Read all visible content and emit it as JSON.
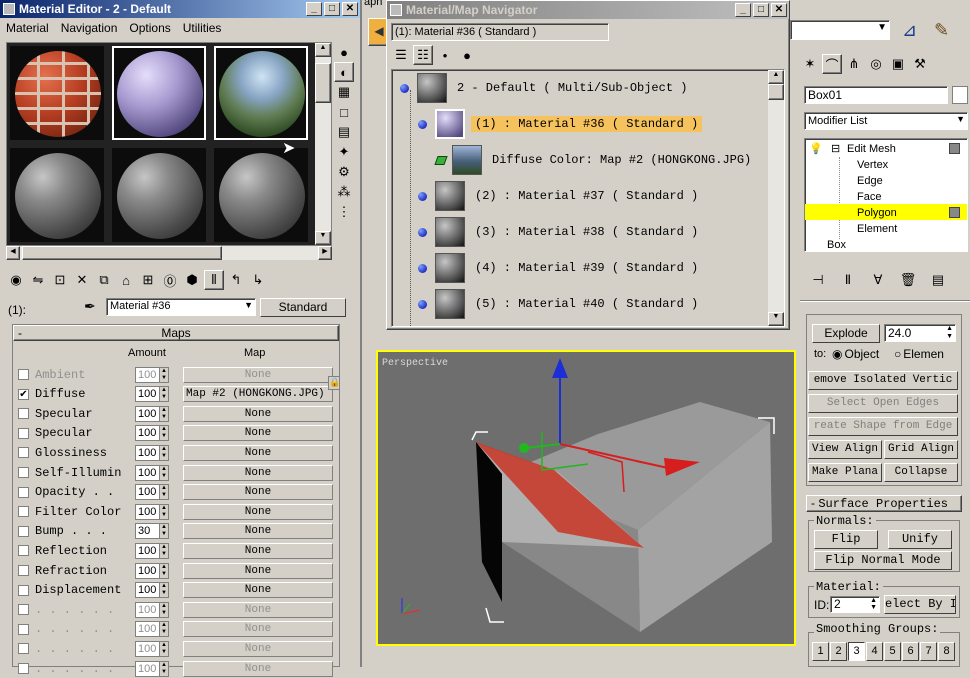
{
  "material_editor": {
    "title": "Material Editor - 2 - Default",
    "menu": [
      "Material",
      "Navigation",
      "Options",
      "Utilities"
    ],
    "slot_label": "(1):",
    "material_name": "Material #36",
    "type_button": "Standard",
    "maps_header": "Maps",
    "col_amount": "Amount",
    "col_map": "Map",
    "maps": [
      {
        "name": "Ambient",
        "checked": false,
        "amount": "100",
        "map": "None",
        "dim": true
      },
      {
        "name": "Diffuse",
        "checked": true,
        "amount": "100",
        "map": "Map #2  (HONGKONG.JPG)",
        "dim": false
      },
      {
        "name": "Specular",
        "checked": false,
        "amount": "100",
        "map": "None",
        "dim": false
      },
      {
        "name": "Specular",
        "checked": false,
        "amount": "100",
        "map": "None",
        "dim": false
      },
      {
        "name": "Glossiness",
        "checked": false,
        "amount": "100",
        "map": "None",
        "dim": false
      },
      {
        "name": "Self-Illumin",
        "checked": false,
        "amount": "100",
        "map": "None",
        "dim": false
      },
      {
        "name": "Opacity . .",
        "checked": false,
        "amount": "100",
        "map": "None",
        "dim": false
      },
      {
        "name": "Filter Color",
        "checked": false,
        "amount": "100",
        "map": "None",
        "dim": false
      },
      {
        "name": "Bump . . .",
        "checked": false,
        "amount": "30",
        "map": "None",
        "dim": false
      },
      {
        "name": "Reflection",
        "checked": false,
        "amount": "100",
        "map": "None",
        "dim": false
      },
      {
        "name": "Refraction",
        "checked": false,
        "amount": "100",
        "map": "None",
        "dim": false
      },
      {
        "name": "Displacement",
        "checked": false,
        "amount": "100",
        "map": "None",
        "dim": false
      },
      {
        "name": ". . . . . .",
        "checked": false,
        "amount": "100",
        "map": "None",
        "dim": true
      },
      {
        "name": ". . . . . .",
        "checked": false,
        "amount": "100",
        "map": "None",
        "dim": true
      },
      {
        "name": ". . . . . .",
        "checked": false,
        "amount": "100",
        "map": "None",
        "dim": true
      },
      {
        "name": ". . . . . .",
        "checked": false,
        "amount": "100",
        "map": "None",
        "dim": true
      }
    ]
  },
  "navigator": {
    "title": "Material/Map Navigator",
    "current": "(1): Material #36  ( Standard )",
    "rows": [
      {
        "text": "2 - Default   ( Multi/Sub-Object )",
        "indent": 0,
        "selected": false,
        "kind": "gray"
      },
      {
        "text": "(1) : Material #36   ( Standard )",
        "indent": 1,
        "selected": true,
        "kind": "purple"
      },
      {
        "text": "Diffuse Color: Map #2 (HONGKONG.JPG)",
        "indent": 2,
        "selected": false,
        "kind": "map"
      },
      {
        "text": "(2) : Material #37   ( Standard )",
        "indent": 1,
        "selected": false,
        "kind": "gray"
      },
      {
        "text": "(3) : Material #38   ( Standard )",
        "indent": 1,
        "selected": false,
        "kind": "gray"
      },
      {
        "text": "(4) : Material #39   ( Standard )",
        "indent": 1,
        "selected": false,
        "kind": "gray"
      },
      {
        "text": "(5) : Material #40   ( Standard )",
        "indent": 1,
        "selected": false,
        "kind": "gray"
      }
    ]
  },
  "viewport": {
    "label": "Perspective"
  },
  "command_panel": {
    "object_name": "Box01",
    "modifier_list": "Modifier List",
    "stack": {
      "root": "Edit Mesh",
      "items": [
        "Vertex",
        "Edge",
        "Face",
        "Polygon",
        "Element"
      ],
      "selected": "Polygon",
      "base": "Box"
    },
    "explode_label": "Explode",
    "explode_value": "24.0",
    "to_label": "to:",
    "radio_object": "Object",
    "radio_elements": "Elemen",
    "remove_isolated": "emove Isolated Vertic",
    "select_open_edges": "Select Open Edges",
    "create_shape": "reate Shape from Edge",
    "view_align": "View Align",
    "grid_align": "Grid Align",
    "make_planar": "Make Plana",
    "collapse": "Collapse",
    "surface_props": "Surface Properties",
    "normals_label": "Normals:",
    "flip": "Flip",
    "unify": "Unify",
    "flip_normal_mode": "Flip Normal Mode",
    "material_label": "Material:",
    "id_label": "ID:",
    "id_value": "2",
    "select_by_id": "elect By I",
    "smoothing_label": "Smoothing Groups:",
    "smoothing": [
      "1",
      "2",
      "3",
      "4",
      "5",
      "6",
      "7",
      "8"
    ]
  },
  "top_strip": {
    "text": "aph"
  },
  "colors": {
    "accent": "#ffff00",
    "selected_row": "#f5c25d",
    "title_active": "#0a246a"
  }
}
